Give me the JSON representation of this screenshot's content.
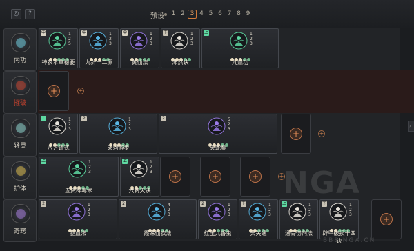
{
  "toolbar": {
    "preset_label": "预设",
    "presets": [
      "1",
      "2",
      "3",
      "4",
      "5",
      "6",
      "7",
      "8",
      "9"
    ],
    "active_preset": "3"
  },
  "rows": [
    {
      "name": "内功",
      "locked": false,
      "accent": "#6cc8d8",
      "cards": [
        {
          "name": "神农本草秘要",
          "tag": "中",
          "tagColor": "#d9d3c4",
          "glow": "#5ed8a2",
          "nums": [
            "1",
            "2",
            "5"
          ],
          "dots": [
            "#e8dcc0",
            "#e8dcc0",
            "#6fb38a",
            "#6fb38a",
            "#6fb38a"
          ]
        },
        {
          "name": "九針十二原",
          "tag": "中",
          "tagColor": "#d9d3c4",
          "glow": "#5ab8e6",
          "nums": [
            "1",
            "2",
            "3"
          ],
          "dots": [
            "#e8dcc0",
            "#e8dcc0",
            "#e8dcc0",
            "#6fb38a",
            "#6fb38a"
          ]
        },
        {
          "name": "黄仙法",
          "tag": "中",
          "tagColor": "#d9d3c4",
          "glow": "#9a7ae8",
          "nums": [
            "1",
            "2",
            "3"
          ],
          "dots": [
            "#e8dcc0",
            "#e8dcc0",
            "#6fb38a",
            "#6fb38a",
            "#6fb38a"
          ]
        },
        {
          "name": "沛然诀",
          "tag": "下",
          "tagColor": "#c8c2b4",
          "glow": "#e8e4dc",
          "nums": [
            "1",
            "2",
            "3"
          ],
          "dots": [
            "#e8dcc0",
            "#e8dcc0",
            "#e8dcc0",
            "#6fb38a",
            "#6fb38a"
          ]
        },
        {
          "name": "九鼎功",
          "tag": "上",
          "tagColor": "#5ed8a2",
          "glow": "#5ed8a2",
          "nums": [
            "1",
            "2",
            "3"
          ],
          "dots": [
            "#e8dcc0",
            "#e8dcc0",
            "#e8dcc0",
            "#6fb38a",
            "#6fb38a"
          ]
        }
      ]
    },
    {
      "name": "摧破",
      "locked": true,
      "accent": "#c2422e",
      "cards": []
    },
    {
      "name": "轻灵",
      "locked": false,
      "accent": "#8ad0c8",
      "cards": [
        {
          "name": "八方请式",
          "tag": "上",
          "tagColor": "#5ed8a2",
          "glow": "#e8e4dc",
          "nums": [
            "1",
            "2",
            "3"
          ],
          "dots": [
            "#e8dcc0",
            "#e8dcc0",
            "#6fb38a",
            "#6fb38a",
            "#6fb38a"
          ]
        },
        {
          "name": "天河游步",
          "tag": "2",
          "tagColor": "#c8c2b4",
          "glow": "#5ab8e6",
          "nums": [
            "1",
            "2",
            "3"
          ],
          "dots": [
            "#e8dcc0",
            "#e8dcc0",
            "#e8dcc0",
            "#6fb38a",
            "#6fb38a"
          ]
        },
        {
          "name": "天蛇翻",
          "tag": "2",
          "tagColor": "#c8c2b4",
          "glow": "#9a7ae8",
          "nums": [
            "5",
            "2",
            "3"
          ],
          "dots": [
            "#e8dcc0",
            "#e8dcc0",
            "#e8dcc0",
            "#6fb38a",
            "#6fb38a"
          ]
        }
      ]
    },
    {
      "name": "护体",
      "locked": false,
      "accent": "#d8b84a",
      "cards": [
        {
          "name": "五资辟毒术",
          "tag": "上",
          "tagColor": "#5ed8a2",
          "glow": "#5ed8a2",
          "nums": [
            "1",
            "2",
            "3"
          ],
          "dots": [
            "#e8dcc0",
            "#e8dcc0",
            "#e8dcc0",
            "#6fb38a",
            "#6fb38a"
          ]
        },
        {
          "name": "六转天诀",
          "tag": "上",
          "tagColor": "#5ed8a2",
          "glow": "#e8e4dc",
          "nums": [
            "1",
            "2",
            "3"
          ],
          "dots": [
            "#e8dcc0",
            "#e8dcc0",
            "#6fb38a",
            "#6fb38a",
            "#6fb38a"
          ]
        }
      ]
    },
    {
      "name": "奇窍",
      "locked": false,
      "accent": "#a47ad8",
      "cards": [
        {
          "name": "驱血法",
          "tag": "2",
          "tagColor": "#c8c2b4",
          "glow": "#9a7ae8",
          "nums": [
            "1",
            "2",
            "3"
          ],
          "dots": [
            "#e8dcc0",
            "#e8dcc0",
            "#e8dcc0",
            "#6fb38a",
            "#6fb38a"
          ]
        },
        {
          "name": "霞殊仙衣法",
          "tag": "2",
          "tagColor": "#c8c2b4",
          "glow": "#5ab8e6",
          "nums": [
            "4",
            "2",
            "3"
          ],
          "dots": [
            "#e8dcc0",
            "#e8dcc0",
            "#e8dcc0",
            "#6fb38a",
            "#6fb38a"
          ]
        },
        {
          "name": "红玉九香虫",
          "tag": "2",
          "tagColor": "#c8c2b4",
          "glow": "#9a7ae8",
          "nums": [
            "1",
            "2",
            "3"
          ],
          "dots": [
            "#e8dcc0",
            "#e8dcc0",
            "#6fb38a",
            "#6fb38a",
            "#6fb38a"
          ]
        },
        {
          "name": "天关通",
          "tag": "下",
          "tagColor": "#c8c2b4",
          "glow": "#5ab8e6",
          "nums": [
            "1",
            "2",
            "3"
          ],
          "dots": [
            "#e8dcc0",
            "#e8dcc0",
            "#6fb38a",
            "#6fb38a",
            "#6fb38a"
          ]
        },
        {
          "name": "通骨伤剂法",
          "tag": "上",
          "tagColor": "#5ed8a2",
          "glow": "#e8e4dc",
          "nums": [
            "1",
            "2",
            "3"
          ],
          "dots": [
            "#e8dcc0",
            "#e8dcc0",
            "#6fb38a",
            "#6fb38a",
            "#6fb38a"
          ]
        },
        {
          "name": "辟甲破损十四诀",
          "tag": "下",
          "tagColor": "#c8c2b4",
          "glow": "#e8e4dc",
          "nums": [
            "1",
            "2",
            "3"
          ],
          "dots": [
            "#e8dcc0",
            "#e8dcc0",
            "#6fb38a",
            "#6fb38a",
            "#6fb38a"
          ]
        }
      ]
    }
  ],
  "empty_slot_label": "+",
  "watermark": "NGA",
  "watermark_sub": "BBS.NGA.CN"
}
